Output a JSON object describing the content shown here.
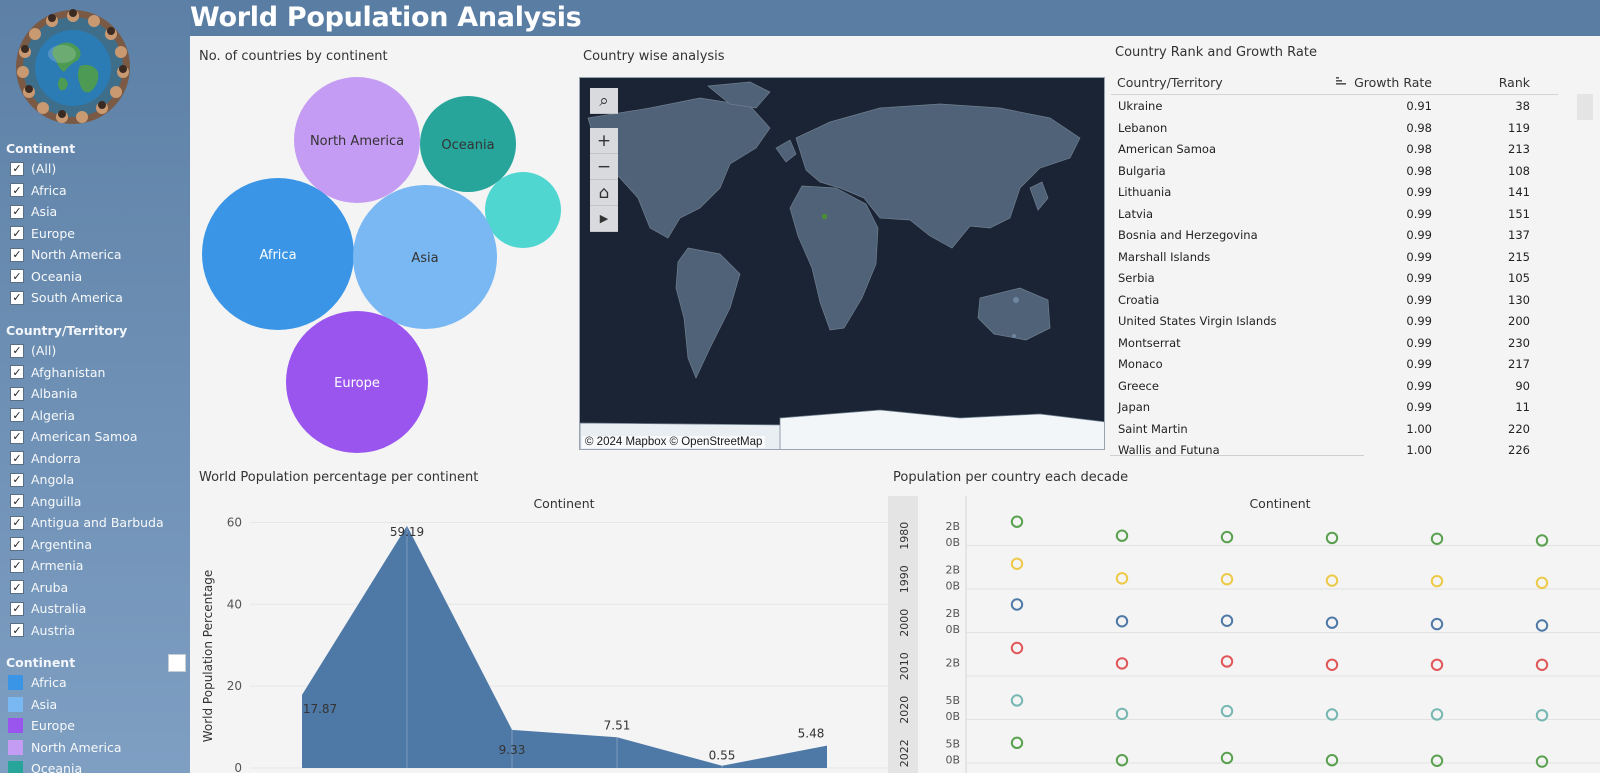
{
  "header": {
    "title": "World Population Analysis"
  },
  "sidebar": {
    "continent_filter": {
      "title": "Continent",
      "items": [
        "(All)",
        "Africa",
        "Asia",
        "Europe",
        "North America",
        "Oceania",
        "South America"
      ]
    },
    "country_filter": {
      "title": "Country/Territory",
      "items": [
        "(All)",
        "Afghanistan",
        "Albania",
        "Algeria",
        "American Samoa",
        "Andorra",
        "Angola",
        "Anguilla",
        "Antigua and Barbuda",
        "Argentina",
        "Armenia",
        "Aruba",
        "Australia",
        "Austria"
      ]
    },
    "color_legend": {
      "title": "Continent",
      "items": [
        {
          "label": "Africa",
          "color": "#3a95e6"
        },
        {
          "label": "Asia",
          "color": "#79b8f2"
        },
        {
          "label": "Europe",
          "color": "#9b55ef"
        },
        {
          "label": "North America",
          "color": "#c59cf3"
        },
        {
          "label": "Oceania",
          "color": "#27a59b"
        }
      ]
    }
  },
  "bubble_panel": {
    "title": "No. of countries by continent",
    "bubbles": [
      {
        "label": "North America",
        "color": "#c59cf3"
      },
      {
        "label": "Oceania",
        "color": "#27a59b"
      },
      {
        "label": "",
        "color": "#4fd6d0"
      },
      {
        "label": "Africa",
        "color": "#3a95e6"
      },
      {
        "label": "Asia",
        "color": "#79b8f2"
      },
      {
        "label": "Europe",
        "color": "#9b55ef"
      }
    ]
  },
  "map_panel": {
    "title": "Country wise analysis",
    "attribution": "© 2024 Mapbox  © OpenStreetMap",
    "tools": [
      "search-icon",
      "zoom-in-icon",
      "zoom-out-icon",
      "home-icon",
      "play-icon"
    ]
  },
  "rank_table": {
    "title": "Country Rank and Growth Rate",
    "columns": [
      "Country/Territory",
      "Growth Rate",
      "Rank"
    ],
    "rows": [
      [
        "Ukraine",
        "0.91",
        "38"
      ],
      [
        "Lebanon",
        "0.98",
        "119"
      ],
      [
        "American Samoa",
        "0.98",
        "213"
      ],
      [
        "Bulgaria",
        "0.98",
        "108"
      ],
      [
        "Lithuania",
        "0.99",
        "141"
      ],
      [
        "Latvia",
        "0.99",
        "151"
      ],
      [
        "Bosnia and Herzegovina",
        "0.99",
        "137"
      ],
      [
        "Marshall Islands",
        "0.99",
        "215"
      ],
      [
        "Serbia",
        "0.99",
        "105"
      ],
      [
        "Croatia",
        "0.99",
        "130"
      ],
      [
        "United States Virgin Islands",
        "0.99",
        "200"
      ],
      [
        "Montserrat",
        "0.99",
        "230"
      ],
      [
        "Monaco",
        "0.99",
        "217"
      ],
      [
        "Greece",
        "0.99",
        "90"
      ],
      [
        "Japan",
        "0.99",
        "11"
      ],
      [
        "Saint Martin",
        "1.00",
        "220"
      ],
      [
        "Wallis and Futuna",
        "1.00",
        "226"
      ]
    ]
  },
  "area_panel": {
    "title": "World Population percentage per continent",
    "header": "Continent",
    "ylabel": "World Population Percentage"
  },
  "dots_panel": {
    "title": "Population per country each decade",
    "header": "Continent"
  },
  "chart_data": [
    {
      "type": "area",
      "title": "World Population percentage per continent",
      "xlabel": "Continent",
      "ylabel": "World Population Percentage",
      "ylim": [
        0,
        65
      ],
      "yticks": [
        0,
        20,
        40,
        60
      ],
      "values": [
        17.87,
        59.19,
        9.33,
        7.51,
        0.55,
        5.48
      ],
      "labels": [
        "17.87",
        "59.19",
        "9.33",
        "7.51",
        "0.55",
        "5.48"
      ],
      "color": "#4e79a7"
    },
    {
      "type": "scatter",
      "title": "Population per country each decade",
      "xlabel": "Continent",
      "rows": [
        {
          "label": "1980",
          "ticks": [
            "2B",
            "0B"
          ],
          "color": "#59a14f",
          "values": [
            0.85,
            0.35,
            0.3,
            0.27,
            0.24,
            0.18
          ]
        },
        {
          "label": "1990",
          "ticks": [
            "2B",
            "0B"
          ],
          "color": "#edc948",
          "values": [
            0.9,
            0.38,
            0.35,
            0.3,
            0.28,
            0.22
          ]
        },
        {
          "label": "2000",
          "ticks": [
            "2B",
            "0B"
          ],
          "color": "#4e79a7",
          "values": [
            1.0,
            0.4,
            0.42,
            0.35,
            0.3,
            0.25
          ]
        },
        {
          "label": "2010",
          "ticks": [
            "2B"
          ],
          "color": "#e15759",
          "values": [
            1.0,
            0.45,
            0.52,
            0.4,
            0.4,
            0.4
          ]
        },
        {
          "label": "2020",
          "ticks": [
            "5B",
            "0B"
          ],
          "color": "#76b7b2",
          "values": [
            0.68,
            0.2,
            0.3,
            0.18,
            0.18,
            0.15
          ]
        },
        {
          "label": "2022",
          "ticks": [
            "5B",
            "0B"
          ],
          "color": "#59a14f",
          "values": [
            0.72,
            0.1,
            0.18,
            0.1,
            0.08,
            0.05
          ]
        }
      ]
    }
  ]
}
